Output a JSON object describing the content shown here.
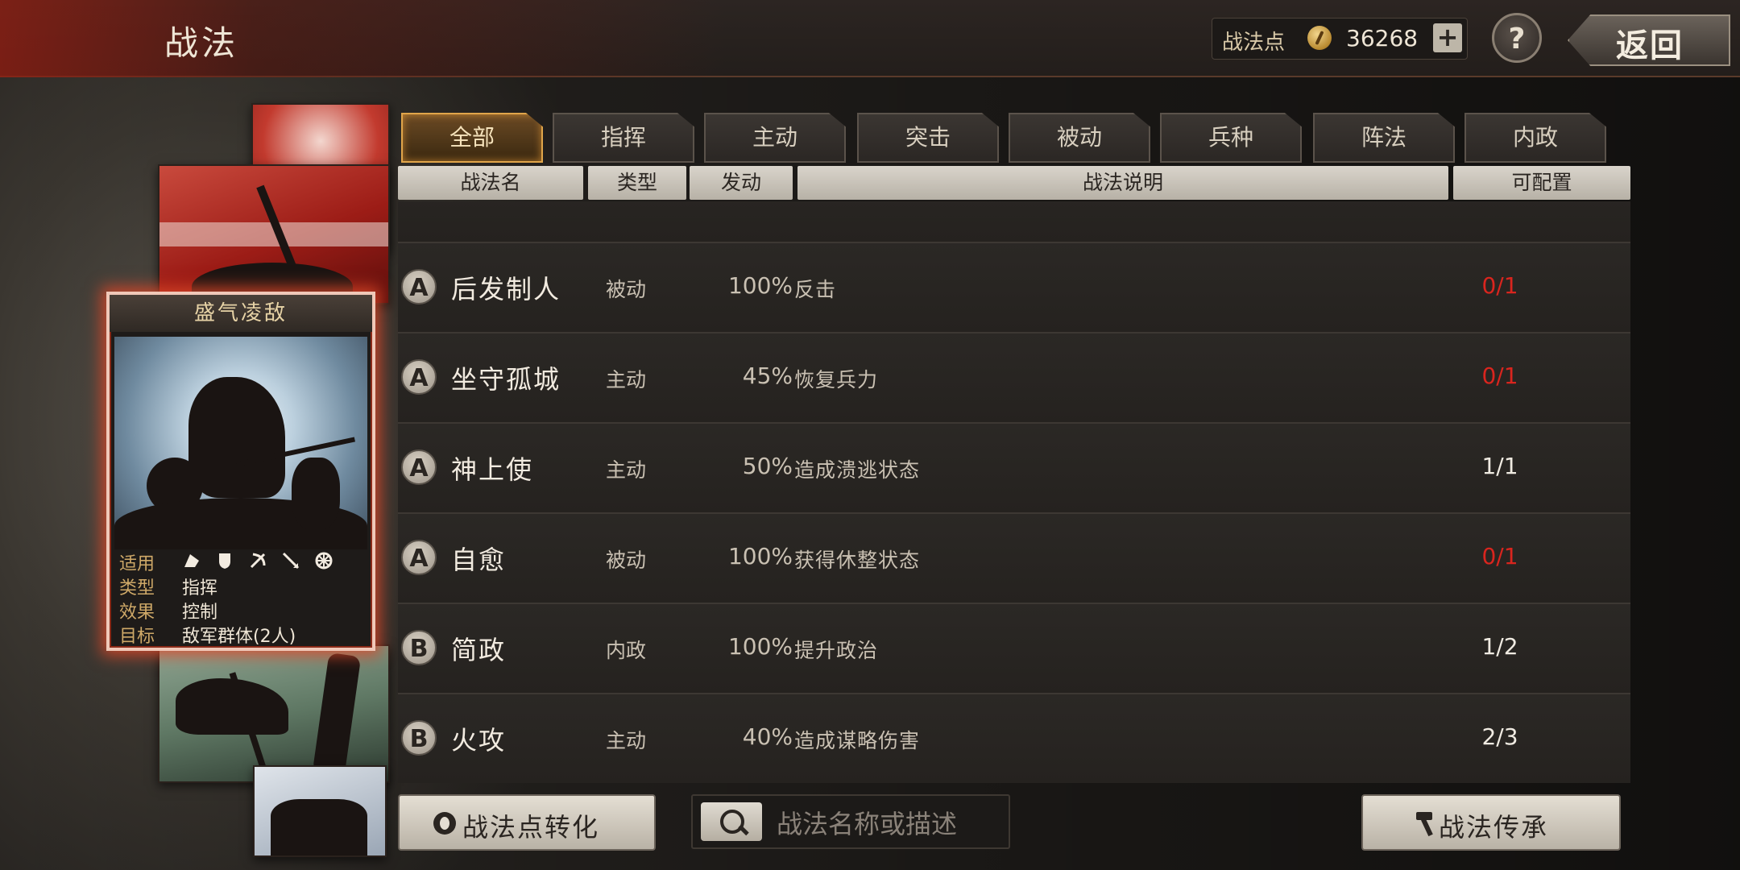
{
  "header": {
    "title": "战法",
    "points_label": "战法点",
    "points_value": "36268",
    "plus_label": "+",
    "help_label": "?",
    "back_label": "返回"
  },
  "featured_card": {
    "title": "盛气凌敌",
    "rows": [
      {
        "key": "适用",
        "value": ""
      },
      {
        "key": "类型",
        "value": "指挥"
      },
      {
        "key": "效果",
        "value": "控制"
      },
      {
        "key": "目标",
        "value": "敌军群体(2人)"
      }
    ],
    "unit_icons": [
      "cavalry-icon",
      "shield-icon",
      "bow-icon",
      "spear-icon",
      "wheel-icon"
    ]
  },
  "tabs": [
    {
      "label": "全部",
      "active": true
    },
    {
      "label": "指挥",
      "active": false
    },
    {
      "label": "主动",
      "active": false
    },
    {
      "label": "突击",
      "active": false
    },
    {
      "label": "被动",
      "active": false
    },
    {
      "label": "兵种",
      "active": false
    },
    {
      "label": "阵法",
      "active": false
    },
    {
      "label": "内政",
      "active": false
    }
  ],
  "columns": {
    "name": "战法名",
    "type": "类型",
    "trigger": "发动",
    "desc": "战法说明",
    "config": "可配置"
  },
  "rows": [
    {
      "grade": "A",
      "name": "后发制人",
      "type": "被动",
      "rate": "100%",
      "desc": "反击",
      "count": "0/1",
      "full": true
    },
    {
      "grade": "A",
      "name": "坐守孤城",
      "type": "主动",
      "rate": "45%",
      "desc": "恢复兵力",
      "count": "0/1",
      "full": true
    },
    {
      "grade": "A",
      "name": "神上使",
      "type": "主动",
      "rate": "50%",
      "desc": "造成溃逃状态",
      "count": "1/1",
      "full": false
    },
    {
      "grade": "A",
      "name": "自愈",
      "type": "被动",
      "rate": "100%",
      "desc": "获得休整状态",
      "count": "0/1",
      "full": true
    },
    {
      "grade": "B",
      "name": "简政",
      "type": "内政",
      "rate": "100%",
      "desc": "提升政治",
      "count": "1/2",
      "full": false
    },
    {
      "grade": "B",
      "name": "火攻",
      "type": "主动",
      "rate": "40%",
      "desc": "造成谋略伤害",
      "count": "2/3",
      "full": false
    }
  ],
  "bottom": {
    "convert_label": "战法点转化",
    "search_placeholder": "战法名称或描述",
    "inherit_label": "战法传承"
  },
  "colors": {
    "accent_red": "#d9251e",
    "tab_active": "#e0a54a"
  }
}
